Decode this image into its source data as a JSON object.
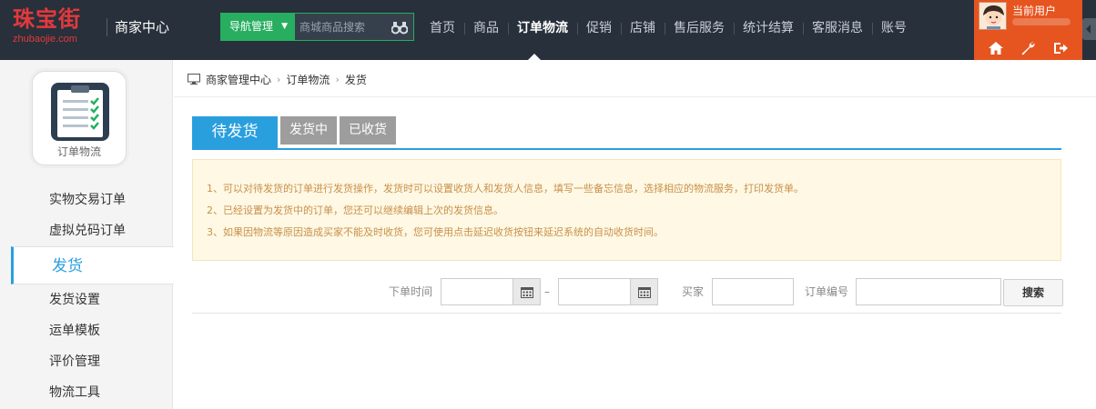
{
  "logo": {
    "cn": "珠宝街",
    "en": "zhubaojie.com"
  },
  "site_title": "商家中心",
  "search": {
    "nav_toggle_label": "导航管理",
    "placeholder": "商城商品搜索"
  },
  "main_nav": {
    "items": [
      "首页",
      "商品",
      "订单物流",
      "促销",
      "店铺",
      "售后服务",
      "统计结算",
      "客服消息",
      "账号"
    ],
    "active": "订单物流"
  },
  "user": {
    "name": "当前用户"
  },
  "sidebar": {
    "module_label": "订单物流",
    "items": [
      "实物交易订单",
      "虚拟兑码订单",
      "发货",
      "发货设置",
      "运单模板",
      "评价管理",
      "物流工具"
    ],
    "active": "发货"
  },
  "breadcrumb": [
    "商家管理中心",
    "订单物流",
    "发货"
  ],
  "tabs": [
    "待发货",
    "发货中",
    "已收货"
  ],
  "notice": [
    "1、可以对待发货的订单进行发货操作，发货时可以设置收货人和发货人信息，填写一些备忘信息，选择相应的物流服务，打印发货单。",
    "2、已经设置为发货中的订单，您还可以继续编辑上次的发货信息。",
    "3、如果因物流等原因造成买家不能及时收货，您可使用点击延迟收货按钮来延迟系统的自动收货时间。"
  ],
  "filter": {
    "order_time_label": "下单时间",
    "range_sep": "–",
    "buyer_label": "买家",
    "order_no_label": "订单编号",
    "search_button": "搜索"
  },
  "colors": {
    "topbar": "#27303b",
    "brand_red": "#e4393c",
    "green": "#27ae60",
    "user_orange": "#e6541f",
    "accent_blue": "#2a9fde",
    "notice_bg": "#fef8e4",
    "notice_text": "#c9904a"
  },
  "icons": [
    "binoculars-icon",
    "home-icon",
    "wrench-icon",
    "logout-icon",
    "monitor-icon",
    "calendar-icon",
    "clipboard-icon"
  ]
}
